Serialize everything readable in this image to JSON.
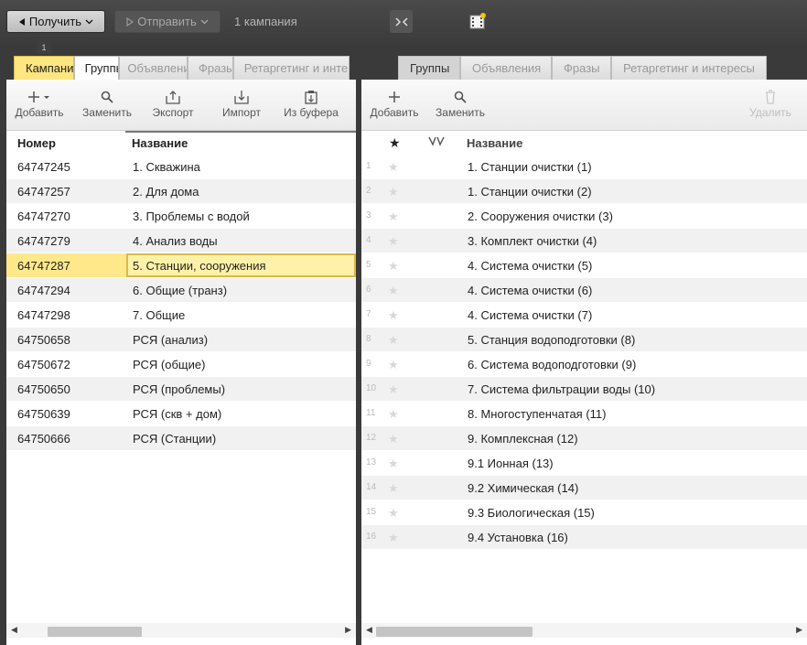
{
  "toolbar": {
    "get_label": "Получить",
    "send_label": "Отправить",
    "campaign_count": "1 кампания",
    "tab_badge": "1"
  },
  "left": {
    "tabs": [
      "Кампании",
      "Группы",
      "Объявления",
      "Фразы",
      "Ретаргетинг и интересы"
    ],
    "tools": [
      "Добавить",
      "Заменить",
      "Экспорт",
      "Импорт",
      "Из буфера"
    ],
    "col_number": "Номер",
    "col_name": "Название",
    "rows": [
      {
        "num": "64747245",
        "name": "1. Скважина"
      },
      {
        "num": "64747257",
        "name": "2. Для дома"
      },
      {
        "num": "64747270",
        "name": "3. Проблемы с водой"
      },
      {
        "num": "64747279",
        "name": "4. Анализ воды"
      },
      {
        "num": "64747287",
        "name": "5. Станции, сооружения"
      },
      {
        "num": "64747294",
        "name": "6. Общие (транз)"
      },
      {
        "num": "64747298",
        "name": "7. Общие"
      },
      {
        "num": "64750658",
        "name": "РСЯ (анализ)"
      },
      {
        "num": "64750672",
        "name": "РСЯ (общие)"
      },
      {
        "num": "64750650",
        "name": "РСЯ (проблемы)"
      },
      {
        "num": "64750639",
        "name": "РСЯ (скв + дом)"
      },
      {
        "num": "64750666",
        "name": "РСЯ (Станции)"
      }
    ],
    "selected_index": 4
  },
  "right": {
    "tabs": [
      "Группы",
      "Объявления",
      "Фразы",
      "Ретаргетинг и интересы"
    ],
    "tools": [
      "Добавить",
      "Заменить"
    ],
    "delete_label": "Удалить",
    "col_name": "Название",
    "rows": [
      {
        "n": "1",
        "name": "1. Станции очистки (1)"
      },
      {
        "n": "2",
        "name": "1. Станции очистки (2)"
      },
      {
        "n": "3",
        "name": "2. Сооружения очистки (3)"
      },
      {
        "n": "4",
        "name": "3. Комплект очистки (4)"
      },
      {
        "n": "5",
        "name": "4. Система очистки (5)"
      },
      {
        "n": "6",
        "name": "4. Система очистки (6)"
      },
      {
        "n": "7",
        "name": "4. Система очистки (7)"
      },
      {
        "n": "8",
        "name": "5. Станция водоподготовки (8)"
      },
      {
        "n": "9",
        "name": "6. Система водоподготовки (9)"
      },
      {
        "n": "10",
        "name": "7. Система фильтрации воды (10)"
      },
      {
        "n": "11",
        "name": "8. Многоступенчатая (11)"
      },
      {
        "n": "12",
        "name": "9. Комплексная (12)"
      },
      {
        "n": "13",
        "name": "9.1 Ионная (13)"
      },
      {
        "n": "14",
        "name": "9.2 Химическая (14)"
      },
      {
        "n": "15",
        "name": "9.3 Биологическая (15)"
      },
      {
        "n": "16",
        "name": "9.4 Установка (16)"
      }
    ]
  }
}
